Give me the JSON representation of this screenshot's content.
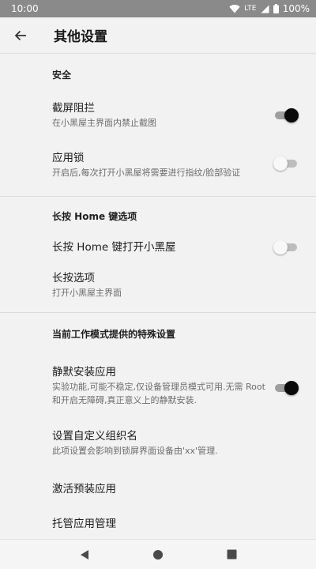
{
  "status_bar": {
    "time": "10:00",
    "network": "LTE",
    "battery": "100%"
  },
  "app_bar": {
    "title": "其他设置"
  },
  "sections": [
    {
      "header": "安全",
      "items": [
        {
          "title": "截屏阻拦",
          "subtitle": "在小黑屋主界面内禁止截图",
          "switch_on": true
        },
        {
          "title": "应用锁",
          "subtitle": "开启后,每次打开小黑屋将需要进行指纹/脸部验证",
          "switch_on": false
        }
      ]
    },
    {
      "header": "长按 Home 键选项",
      "items": [
        {
          "title": "长按 Home 键打开小黑屋",
          "switch_on": false
        },
        {
          "title": "长按选项",
          "subtitle": "打开小黑屋主界面"
        }
      ]
    },
    {
      "header": "当前工作模式提供的特殊设置",
      "items": [
        {
          "title": "静默安装应用",
          "subtitle": "实验功能,可能不稳定,仅设备管理员模式可用.无需 Root 和开启无障碍,真正意义上的静默安装.",
          "switch_on": true
        },
        {
          "title": "设置自定义组织名",
          "subtitle": "此项设置会影响到锁屏界面设备由'xx'管理."
        },
        {
          "title": "激活预装应用"
        },
        {
          "title": "托管应用管理"
        }
      ]
    }
  ]
}
